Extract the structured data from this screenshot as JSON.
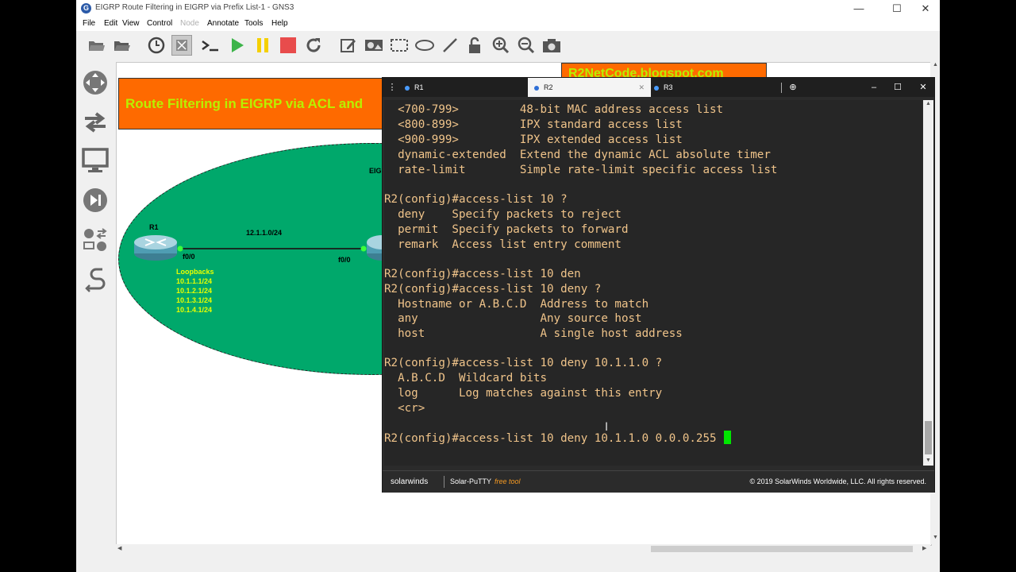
{
  "window": {
    "title": "EIGRP Route Filtering in EIGRP via Prefix List-1 - GNS3",
    "minimize": "—",
    "maximize": "☐",
    "close": "✕"
  },
  "menu": [
    "File",
    "Edit",
    "View",
    "Control",
    "Node",
    "Annotate",
    "Tools",
    "Help"
  ],
  "canvas": {
    "banner_title": "Route Filtering in EIGRP via ACL and",
    "banner_site": "R2NetCode.blogspot.com",
    "r1_label": "R1",
    "link_label": "12.1.1.0/24",
    "r1_port": "f0/0",
    "r2_port": "f0/0",
    "area_label": "EIG",
    "loopbacks_title": "Loopbacks",
    "loopbacks": [
      "10.1.1.1/24",
      "10.1.2.1/24",
      "10.1.3.1/24",
      "10.1.4.1/24"
    ]
  },
  "terminal": {
    "tabs": [
      {
        "label": "R1",
        "active": false
      },
      {
        "label": "R2",
        "active": true
      },
      {
        "label": "R3",
        "active": false
      }
    ],
    "new_tab": "⊕",
    "lines": [
      "  <700-799>         48-bit MAC address access list",
      "  <800-899>         IPX standard access list",
      "  <900-999>         IPX extended access list",
      "  dynamic-extended  Extend the dynamic ACL absolute timer",
      "  rate-limit        Simple rate-limit specific access list",
      "",
      "R2(config)#access-list 10 ?",
      "  deny    Specify packets to reject",
      "  permit  Specify packets to forward",
      "  remark  Access list entry comment",
      "",
      "R2(config)#access-list 10 den",
      "R2(config)#access-list 10 deny ?",
      "  Hostname or A.B.C.D  Address to match",
      "  any                  Any source host",
      "  host                 A single host address",
      "",
      "R2(config)#access-list 10 deny 10.1.1.0 ?",
      "  A.B.C.D  Wildcard bits",
      "  log      Log matches against this entry",
      "  <cr>",
      "",
      "R2(config)#access-list 10 deny 10.1.1.0 0.0.0.255 "
    ],
    "footer_brand": "solarwinds",
    "footer_product": "Solar-PuTTY",
    "footer_free": "free tool",
    "footer_copyright": "© 2019 SolarWinds Worldwide, LLC. All rights reserved."
  },
  "colors": {
    "banner_bg": "#fe6a00",
    "banner_text": "#b8f000",
    "area_fill": "#00a86b",
    "terminal_text": "#f0c48a",
    "cursor": "#00e600"
  }
}
